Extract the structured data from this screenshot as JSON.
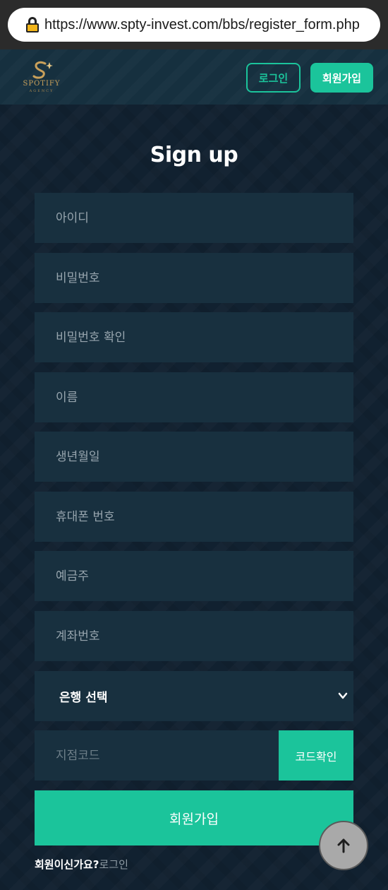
{
  "browser": {
    "url": "https://www.spty-invest.com/bbs/register_form.php",
    "lock_icon": "lock-icon"
  },
  "header": {
    "logo_text": "SPOTIFY",
    "logo_sub": "AGENCY",
    "login_label": "로그인",
    "join_label": "회원가입"
  },
  "form": {
    "title": "Sign up",
    "fields": {
      "username": "아이디",
      "password": "비밀번호",
      "password_confirm": "비밀번호 확인",
      "name": "이름",
      "birthdate": "생년월일",
      "phone": "휴대폰 번호",
      "account_holder": "예금주",
      "account_number": "계좌번호",
      "branch_code": "지점코드"
    },
    "bank_select": "은행 선택",
    "code_check_label": "코드확인",
    "submit_label": "회원가입",
    "member_question": "회원이신가요?",
    "login_link": "로그인"
  },
  "colors": {
    "accent": "#1bc49b",
    "background": "#112130",
    "field_bg": "#18303f"
  },
  "icons": {
    "scroll_top": "arrow-up-icon",
    "select": "chevron-down-icon"
  }
}
